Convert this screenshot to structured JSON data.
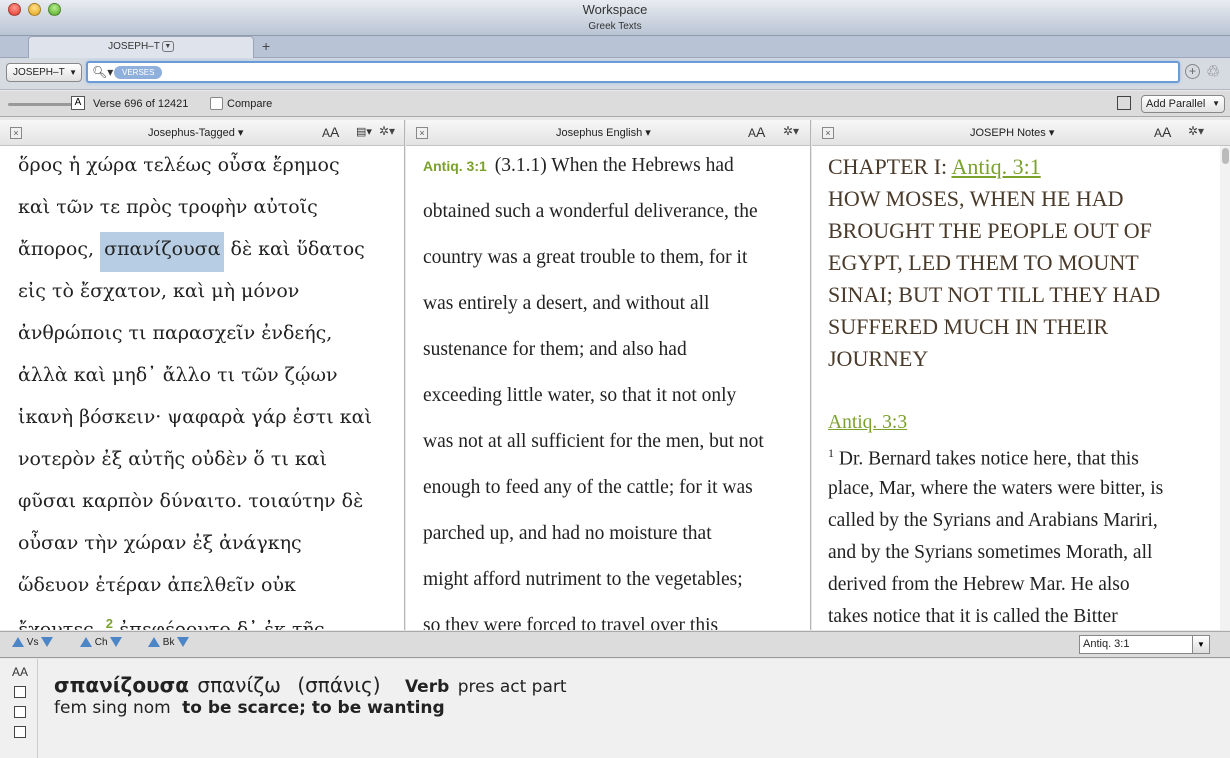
{
  "window": {
    "title": "Workspace",
    "subtitle": "Greek Texts"
  },
  "tabs": {
    "active_label": "JOSEPH–T",
    "add_symbol": "+"
  },
  "search": {
    "resource": "JOSEPH–T",
    "scope_pill": "VERSES",
    "query": ""
  },
  "toolbar": {
    "font_a": "A",
    "verse_info": "Verse 696 of 12421",
    "compare_label": "Compare",
    "add_parallel_label": "Add Parallel"
  },
  "panes": [
    {
      "title": "Josephus-Tagged",
      "lines": [
        "ὅρος ἡ χώρα τελέως οὖσα ἔρημος",
        "καὶ τῶν τε πρὸς τροφὴν αὐτοῖς",
        "ἄπορος,",
        "σπανίζουσα",
        " δὲ καὶ ὕδατος",
        "εἰς τὸ ἔσχατον, καὶ μὴ μόνον",
        "ἀνθρώποις τι παρασχεῖν ἐνδεής,",
        "ἀλλὰ καὶ μηδ᾽ ἄλλο τι τῶν ζῴων",
        "ἱκανὴ βόσκειν· ψαφαρὰ γάρ ἐστι καὶ",
        "νοτερὸν ἐξ αὐτῆς οὐδὲν ὅ τι καὶ",
        "φῦσαι καρπὸν δύναιτο. τοιαύτην δὲ",
        "οὖσαν τὴν χώραν ἐξ ἀνάγκης",
        "ὥδευον ἑτέραν ἀπελθεῖν οὐκ",
        "ἔχοντες.",
        "2",
        " ἐπεφέροντο δ᾽ ἐκ τῆς"
      ]
    },
    {
      "title": "Josephus English",
      "ref": "Antiq. 3:1",
      "lines": [
        "(3.1.1) When the Hebrews had",
        "obtained such a wonderful deliverance, the",
        "country was a great trouble to them, for it",
        "was entirely a desert, and without all",
        "sustenance for them; and also had",
        "exceeding little water, so that it not only",
        "was not at all sufficient for the men, but not",
        "enough to feed any of the cattle; for it was",
        "parched up, and had no moisture that",
        "might afford nutriment to the vegetables;",
        "so they were forced to travel over this"
      ]
    },
    {
      "title": "JOSEPH Notes",
      "chapter_label": "CHAPTER I:",
      "chapter_ref": "Antiq. 3:1",
      "heading_lines": [
        "HOW MOSES, WHEN HE HAD",
        "BROUGHT THE PEOPLE OUT OF",
        "EGYPT, LED THEM TO MOUNT",
        "SINAI; BUT NOT TILL THEY HAD",
        "SUFFERED MUCH IN THEIR",
        "JOURNEY"
      ],
      "note_ref": "Antiq. 3:3",
      "note_marker": "1",
      "note_lines": [
        "Dr. Bernard takes notice here, that this",
        "place, Mar, where the waters were bitter, is",
        "called by the Syrians and Arabians Mariri,",
        "and by the Syrians sometimes Morath, all",
        "derived from the Hebrew Mar. He also",
        "takes notice that it is called the Bitter"
      ]
    }
  ],
  "navigation": {
    "vs": "Vs",
    "ch": "Ch",
    "bk": "Bk",
    "reference": "Antiq. 3:1"
  },
  "info": {
    "aa": "AA",
    "word": "σπανίζουσα",
    "lemma": "σπανίζω",
    "root": "(σπάνις)",
    "pos": "Verb",
    "parse1": "pres act part",
    "parse2": "fem sing nom",
    "gloss": "to be scarce; to be wanting"
  },
  "colors": {
    "verse_green": "#7ba12d",
    "selection_blue": "#b6cde3",
    "nav_arrow_blue": "#4d86c6"
  }
}
